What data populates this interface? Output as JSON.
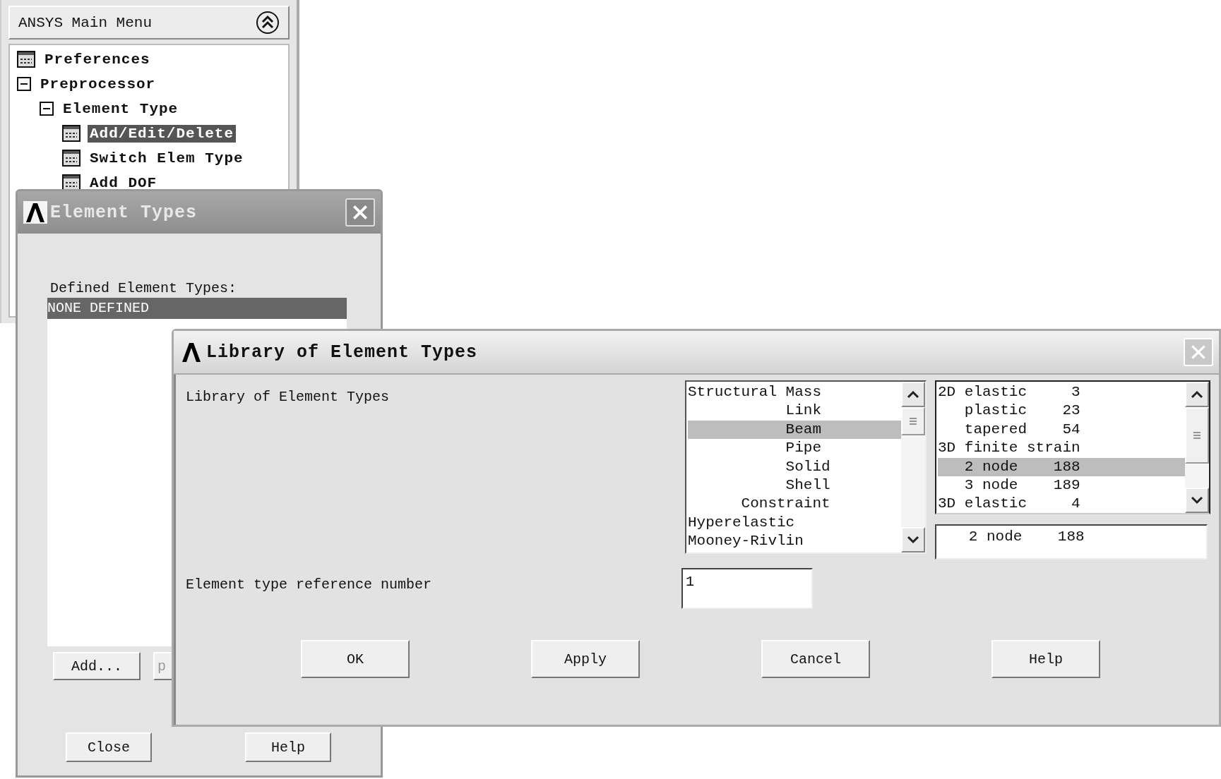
{
  "main_menu": {
    "title": "ANSYS Main Menu",
    "tree": [
      {
        "label": "Preferences",
        "kind": "leaf",
        "selected": false
      },
      {
        "label": "Preprocessor",
        "kind": "branch",
        "expanded": true,
        "selected": false,
        "children": [
          {
            "label": "Element Type",
            "kind": "branch",
            "expanded": true,
            "selected": false,
            "children": [
              {
                "label": "Add/Edit/Delete",
                "kind": "leaf",
                "selected": true
              },
              {
                "label": "Switch Elem Type",
                "kind": "leaf",
                "selected": false
              },
              {
                "label": "Add DOF",
                "kind": "leaf",
                "selected": false
              }
            ]
          }
        ]
      }
    ]
  },
  "element_types": {
    "title": "Element Types",
    "list_label": "Defined Element Types:",
    "items": [
      {
        "text": "NONE DEFINED",
        "selected": true
      }
    ],
    "buttons": [
      "Add...",
      "p"
    ],
    "bottom_buttons": [
      "Close",
      "Help"
    ]
  },
  "library": {
    "title": "Library of Element Types",
    "label": "Library of Element Types",
    "categories": [
      {
        "text": "Structural Mass",
        "selected": false
      },
      {
        "text": "           Link",
        "selected": false
      },
      {
        "text": "           Beam",
        "selected": true
      },
      {
        "text": "           Pipe",
        "selected": false
      },
      {
        "text": "           Solid",
        "selected": false
      },
      {
        "text": "           Shell",
        "selected": false
      },
      {
        "text": "      Constraint",
        "selected": false
      },
      {
        "text": "Hyperelastic",
        "selected": false
      },
      {
        "text": "Mooney-Rivlin",
        "selected": false
      }
    ],
    "types": [
      {
        "text": "2D elastic     3",
        "selected": false
      },
      {
        "text": "   plastic    23",
        "selected": false
      },
      {
        "text": "   tapered    54",
        "selected": false
      },
      {
        "text": "3D finite strain",
        "selected": false
      },
      {
        "text": "   2 node    188",
        "selected": true
      },
      {
        "text": "   3 node    189",
        "selected": false
      },
      {
        "text": "3D elastic     4",
        "selected": false
      }
    ],
    "selection": "   2 node    188",
    "ref_label": "Element type reference number",
    "ref_value": "1",
    "buttons": [
      "OK",
      "Apply",
      "Cancel",
      "Help"
    ]
  }
}
